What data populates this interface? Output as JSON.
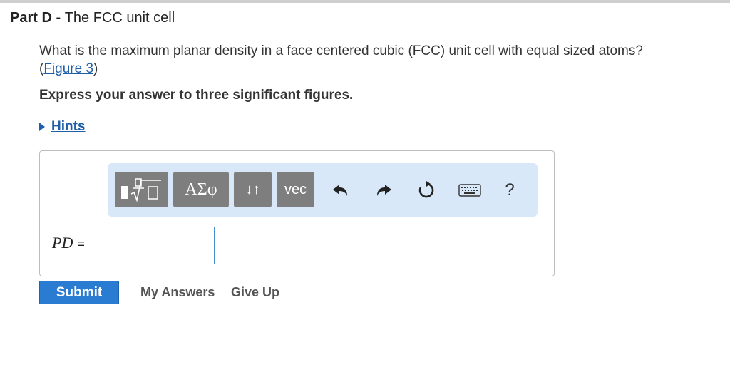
{
  "part": {
    "label": "Part D",
    "separator": " - ",
    "title": "The FCC unit cell"
  },
  "question": {
    "text": "What is the maximum planar density in a face centered cubic (FCC) unit cell with equal sized atoms? ",
    "open_paren": "(",
    "figure_link": "Figure 3",
    "close_paren": ")"
  },
  "instruction": "Express your answer to three significant figures.",
  "hints": {
    "label": "Hints"
  },
  "toolbar": {
    "buttons": [
      {
        "name": "templates",
        "icon": "fraction-sqrt-icon"
      },
      {
        "name": "greek",
        "label": "ΑΣφ"
      },
      {
        "name": "arrows",
        "label": "↓↑"
      },
      {
        "name": "vec",
        "label": "vec"
      }
    ],
    "icons": [
      "undo-icon",
      "redo-icon",
      "reset-icon",
      "keyboard-icon",
      "help-icon"
    ],
    "help_label": "?"
  },
  "answer": {
    "variable": "PD",
    "equals": "=",
    "value": ""
  },
  "actions": {
    "submit": "Submit",
    "my_answers": "My Answers",
    "give_up": "Give Up"
  },
  "colors": {
    "link": "#1f5ea8",
    "toolbar_bg": "#d8e8f8",
    "toolbar_button": "#7e7e7e",
    "submit_bg": "#2a7bd2",
    "input_border": "#4a8ed0"
  }
}
